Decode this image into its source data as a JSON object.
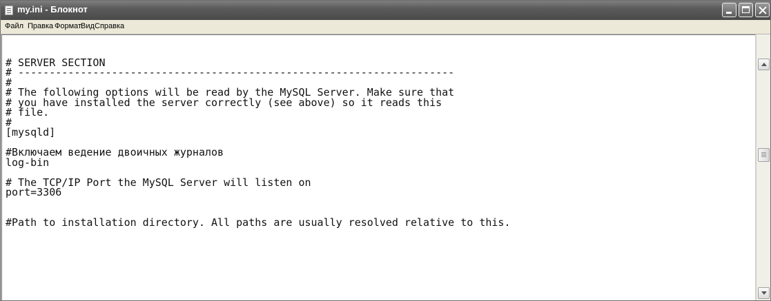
{
  "window": {
    "title": "my.ini - Блокнот",
    "icon": "notepad-icon",
    "controls": [
      "minimize-icon",
      "maximize-icon",
      "close-icon"
    ]
  },
  "menu": {
    "items": [
      {
        "label": "Файл"
      },
      {
        "label": "Правка"
      },
      {
        "label": "Формат"
      },
      {
        "label": "Вид"
      },
      {
        "label": "Справка"
      }
    ]
  },
  "editor": {
    "lines": [
      "# SERVER SECTION",
      "# ----------------------------------------------------------------------",
      "#",
      "# The following options will be read by the MySQL Server. Make sure that",
      "# you have installed the server correctly (see above) so it reads this",
      "# file.",
      "#",
      "[mysqld]",
      "",
      "#Включаем ведение двоичных журналов",
      "log-bin",
      "",
      "# The TCP/IP Port the MySQL Server will listen on",
      "port=3306",
      "",
      "",
      "#Path to installation directory. All paths are usually resolved relative to this."
    ]
  },
  "scrollbar": {
    "up_icon": "scroll-up-arrow-icon",
    "down_icon": "scroll-down-arrow-icon",
    "thumb_icon": "scroll-thumb-grip-icon"
  }
}
